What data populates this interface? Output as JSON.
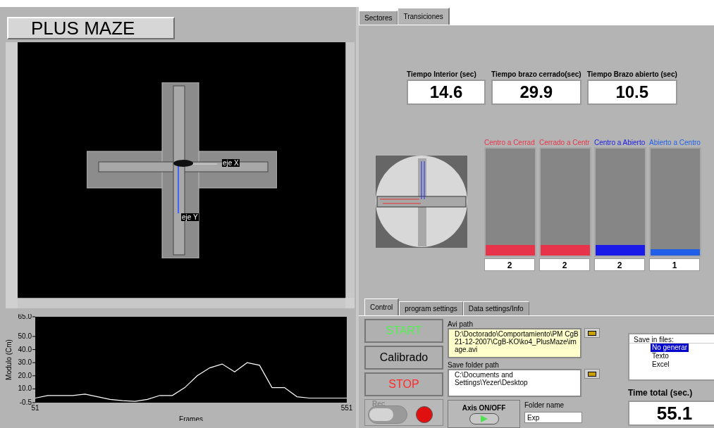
{
  "title": "PLUS MAZE",
  "video": {
    "x_axis_label": "eje X",
    "y_axis_label": "eje Y"
  },
  "chart": {
    "chart_data": {
      "type": "line",
      "xlabel": "Frames",
      "ylabel": "Modulo (Cm)",
      "x": [
        51,
        71,
        91,
        111,
        131,
        151,
        171,
        191,
        211,
        231,
        251,
        271,
        291,
        311,
        331,
        351,
        371,
        391,
        411,
        431,
        451,
        471,
        491,
        511,
        531,
        551
      ],
      "series": [
        {
          "color": "#ffffff",
          "values": [
            3,
            5,
            5,
            5,
            6,
            4,
            2,
            1,
            0.5,
            2,
            5,
            5,
            11,
            20,
            26,
            29,
            23,
            30,
            28,
            11,
            11,
            4,
            3,
            3,
            3,
            3
          ]
        }
      ],
      "xlim": [
        51,
        551
      ],
      "ylim": [
        -0.5,
        65
      ],
      "xticks": [
        51,
        551
      ],
      "yticks": [
        -0.5,
        {
          "value": 10,
          "label": "10.0"
        },
        {
          "value": 20,
          "label": "20.0"
        },
        {
          "value": 30,
          "label": "30.0"
        },
        {
          "value": 40,
          "label": "40.0"
        },
        {
          "value": 50,
          "label": "50.0"
        },
        {
          "value": 65,
          "label": "65.0"
        }
      ]
    }
  },
  "top_tabs": [
    {
      "label": "Sectores",
      "selected": false
    },
    {
      "label": "Transiciones",
      "selected": true
    }
  ],
  "times": [
    {
      "label": "Tiempo Interior (sec)",
      "value": "14.6"
    },
    {
      "label": "Tiempo brazo  cerrado(sec)",
      "value": "29.9"
    },
    {
      "label": "Tiempo Brazo abierto (sec)",
      "value": "10.5"
    }
  ],
  "transitions": [
    {
      "label": "Centro a Cerrad",
      "color": "#e8344a",
      "level": 0.1,
      "count": "2"
    },
    {
      "label": "Cerrado a Centr",
      "color": "#e8344a",
      "level": 0.1,
      "count": "2"
    },
    {
      "label": "Centro a Abierto",
      "color": "#1a1ae8",
      "level": 0.1,
      "count": "2"
    },
    {
      "label": "Abierto a Centro",
      "color": "#2060e8",
      "level": 0.06,
      "count": "1"
    }
  ],
  "control_tabs": [
    {
      "label": "Control",
      "selected": true
    },
    {
      "label": "program settings",
      "selected": false
    },
    {
      "label": "Data settings/Info",
      "selected": false
    }
  ],
  "buttons": [
    {
      "label": "START",
      "color": "#55ee55"
    },
    {
      "label": "Calibrado",
      "color": "#000000"
    },
    {
      "label": "STOP",
      "color": "#ff2a2a"
    }
  ],
  "rec": {
    "label": "Rec",
    "switch_on": false,
    "on": true
  },
  "avi_path": {
    "label": "Avi path",
    "value": "D:\\Doctorado\\Comportamiento\\PM CgB 21-12-2007\\CgB-KO\\ko4_PlusMaze\\image.avi"
  },
  "save_folder": {
    "label": "Save folder path",
    "value": "C:\\Documents and Settings\\Yezer\\Desktop"
  },
  "axis": {
    "label": "Axis ON/OFF",
    "on": true
  },
  "folder_name": {
    "label": "Folder name",
    "value": "Exp"
  },
  "save_in_files": {
    "header": "Save in files:",
    "options": [
      {
        "label": "No generar",
        "selected": true
      },
      {
        "label": "Texto",
        "selected": false
      },
      {
        "label": "Excel",
        "selected": false
      }
    ]
  },
  "time_total": {
    "label": "Time total (sec.)",
    "value": "55.1"
  }
}
